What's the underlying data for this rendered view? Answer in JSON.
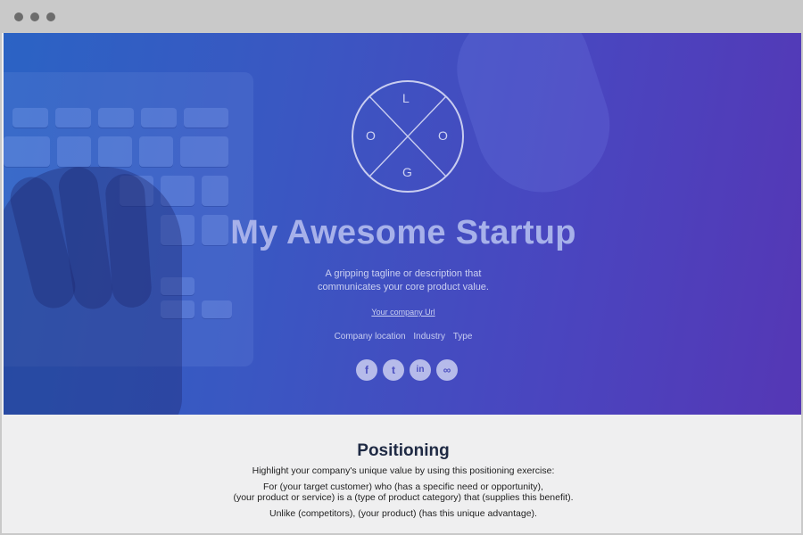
{
  "hero": {
    "logo_letters": {
      "top": "L",
      "left": "O",
      "right": "O",
      "bottom": "G"
    },
    "title": "My Awesome Startup",
    "tagline_line1": "A gripping tagline or description that",
    "tagline_line2": "communicates your core product value.",
    "company_url": "Your company Url",
    "meta": [
      "Company location",
      "Industry",
      "Type"
    ],
    "socials": [
      {
        "name": "facebook-icon",
        "glyph": "f"
      },
      {
        "name": "twitter-icon",
        "glyph": "t"
      },
      {
        "name": "linkedin-icon",
        "glyph": "in"
      },
      {
        "name": "link-icon",
        "glyph": "∞"
      }
    ]
  },
  "positioning": {
    "title": "Positioning",
    "intro": "Highlight your company's unique value by using this positioning exercise:",
    "line1": "For (your target customer) who (has a specific need or opportunity),",
    "line2": "(your product or service) is a (type of product category) that (supplies this benefit).",
    "line3": "Unlike (competitors), (your product) (has this unique advantage)."
  },
  "colors": {
    "hero_gradient_start": "#2b63c4",
    "hero_gradient_end": "#5537b5",
    "title_color": "#a7b1ea",
    "body_bg": "#efeff0"
  }
}
